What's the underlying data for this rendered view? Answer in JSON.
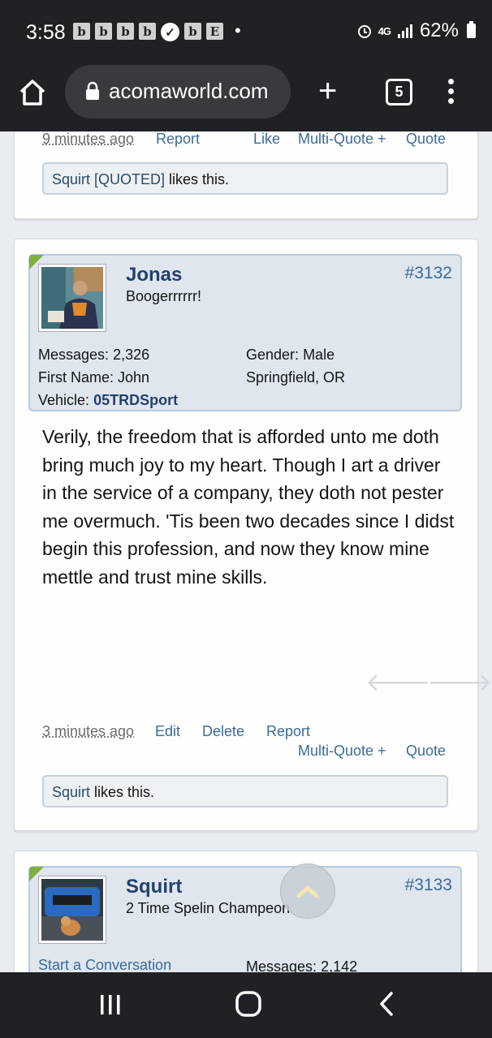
{
  "status_bar": {
    "time": "3:58",
    "notif_letters": [
      "b",
      "b",
      "b",
      "b",
      "b",
      "E"
    ],
    "network": "4G",
    "battery": "62%"
  },
  "browser": {
    "url": "acomaworld.com",
    "tab_count": "5"
  },
  "prev_post": {
    "time": "9 minutes ago",
    "report": "Report",
    "like": "Like",
    "multi_quote": "Multi-Quote +",
    "quote": "Quote",
    "likes_user": "Squirt [QUOTED]",
    "likes_suffix": " likes this."
  },
  "post": {
    "username": "Jonas",
    "user_title": "Boogerrrrrr!",
    "number": "#3132",
    "messages_label": "Messages:",
    "messages_value": "2,326",
    "gender_label": "Gender:",
    "gender_value": "Male",
    "firstname_label": "First Name:",
    "firstname_value": "John",
    "location": "Springfield, OR",
    "vehicle_label": "Vehicle:",
    "vehicle_value": "05TRDSport",
    "message": "Verily, the freedom that is afforded unto me doth bring much joy to my heart. Though I art a driver in the service of a company, they doth not pester me overmuch. 'Tis been two decades since I didst begin this profession, and now they know mine mettle and trust mine skills.",
    "time": "3 minutes ago",
    "edit": "Edit",
    "delete": "Delete",
    "report": "Report",
    "multi_quote": "Multi-Quote +",
    "quote": "Quote",
    "likes_user": "Squirt",
    "likes_suffix": " likes this."
  },
  "next_post": {
    "username": "Squirt",
    "user_title": "2 Time Spelin Champeon",
    "number": "#3133",
    "start_conversation": "Start a Conversation",
    "messages_label": "Messages:",
    "messages_value": "2,142"
  },
  "colors": {
    "link": "#3c6b96",
    "username": "#23416b",
    "badge": "#7fb03d",
    "userbox_bg": "#dfe6ee"
  },
  "icons": [
    "home-icon",
    "lock-icon",
    "plus-icon",
    "tabs-icon",
    "menu-icon",
    "arrow-left-icon",
    "arrow-right-icon",
    "chevron-up-icon",
    "recents-icon",
    "home-nav-icon",
    "back-icon"
  ]
}
